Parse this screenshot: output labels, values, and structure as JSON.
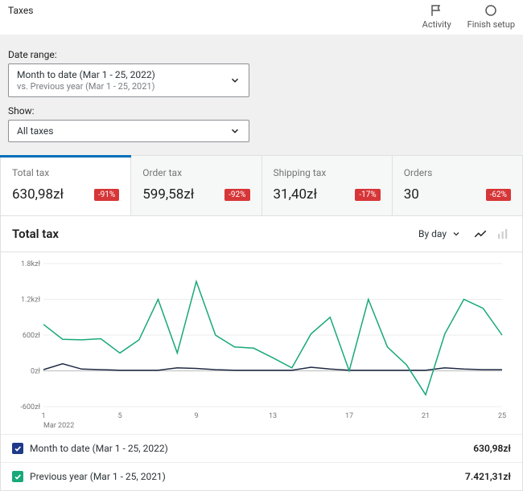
{
  "page": {
    "title": "Taxes"
  },
  "top_actions": {
    "activity": "Activity",
    "finish_setup": "Finish setup"
  },
  "filters": {
    "date_range_label": "Date range:",
    "date_range_main": "Month to date (Mar 1 - 25, 2022)",
    "date_range_sub": "vs. Previous year (Mar 1 - 25, 2021)",
    "show_label": "Show:",
    "show_value": "All taxes"
  },
  "tabs": [
    {
      "label": "Total tax",
      "value": "630,98zł",
      "delta": "-91%",
      "active": true
    },
    {
      "label": "Order tax",
      "value": "599,58zł",
      "delta": "-92%",
      "active": false
    },
    {
      "label": "Shipping tax",
      "value": "31,40zł",
      "delta": "-17%",
      "active": false
    },
    {
      "label": "Orders",
      "value": "30",
      "delta": "-62%",
      "active": false
    }
  ],
  "chart": {
    "title": "Total tax",
    "interval": "By day",
    "x_month_label": "Mar 2022"
  },
  "legend": [
    {
      "label": "Month to date (Mar 1 - 25, 2022)",
      "value": "630,98zł",
      "color": "blue"
    },
    {
      "label": "Previous year (Mar 1 - 25, 2021)",
      "value": "7.421,31zł",
      "color": "green"
    }
  ],
  "chart_data": {
    "type": "line",
    "xlabel": "Mar 2022",
    "ylabel": "",
    "ylim": [
      -600,
      1800
    ],
    "y_ticks": [
      -600,
      0,
      600,
      1200,
      1800
    ],
    "y_tick_labels": [
      "-600zł",
      "0zł",
      "600zł",
      "1.2kzł",
      "1.8kzł"
    ],
    "x": [
      1,
      2,
      3,
      4,
      5,
      6,
      7,
      8,
      9,
      10,
      11,
      12,
      13,
      14,
      15,
      16,
      17,
      18,
      19,
      20,
      21,
      22,
      23,
      24,
      25
    ],
    "x_tick_values": [
      1,
      5,
      9,
      13,
      17,
      21,
      25
    ],
    "x_tick_labels": [
      "1",
      "5",
      "9",
      "13",
      "17",
      "21",
      "25"
    ],
    "series": [
      {
        "name": "Month to date (Mar 1 - 25, 2022)",
        "color": "#1f2a44",
        "values": [
          20,
          120,
          30,
          20,
          10,
          10,
          10,
          50,
          40,
          20,
          10,
          10,
          10,
          10,
          60,
          30,
          10,
          10,
          10,
          10,
          10,
          50,
          30,
          20,
          20
        ]
      },
      {
        "name": "Previous year (Mar 1 - 25, 2021)",
        "color": "#18a87b",
        "values": [
          780,
          530,
          520,
          540,
          300,
          520,
          1200,
          300,
          1500,
          600,
          400,
          380,
          220,
          50,
          620,
          900,
          0,
          1200,
          400,
          100,
          -400,
          620,
          1200,
          1050,
          600
        ]
      }
    ]
  }
}
